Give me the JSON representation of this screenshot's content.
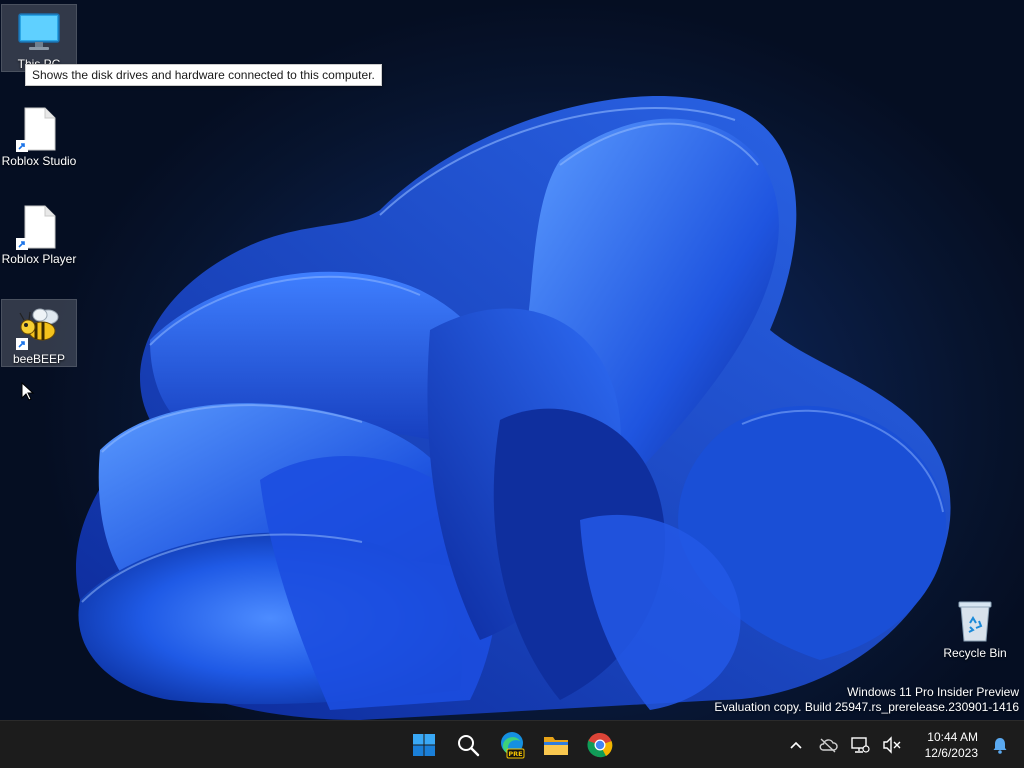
{
  "desktop": {
    "icons": [
      {
        "label": "This PC",
        "icon": "monitor-icon",
        "selected": true
      },
      {
        "label": "Roblox Studio",
        "icon": "shortcut-file-icon"
      },
      {
        "label": "Roblox Player",
        "icon": "shortcut-file-icon"
      },
      {
        "label": "beeBEEP",
        "icon": "bee-icon",
        "selected": true
      },
      {
        "label": "Recycle Bin",
        "icon": "recycle-bin-icon"
      }
    ],
    "tooltip": "Shows the disk drives and hardware connected to this computer.",
    "watermark": {
      "line1": "Windows 11 Pro Insider Preview",
      "line2": "Evaluation copy. Build 25947.rs_prerelease.230901-1416"
    }
  },
  "taskbar": {
    "apps": [
      "windows-start-icon",
      "search-icon",
      "edge-preview-icon",
      "file-explorer-icon",
      "chrome-icon"
    ],
    "edge_badge": "PRE",
    "tray_icons": [
      "chevron-up-icon",
      "cloud-offline-icon",
      "network-icon",
      "volume-muted-icon"
    ],
    "clock": {
      "time": "10:44 AM",
      "date": "12/6/2023"
    },
    "notification_icon": "bell-icon"
  },
  "colors": {
    "accent": "#2a6cf0",
    "taskbar_bg": "#1c1c1c",
    "wallpaper_deep": "#07142e"
  }
}
